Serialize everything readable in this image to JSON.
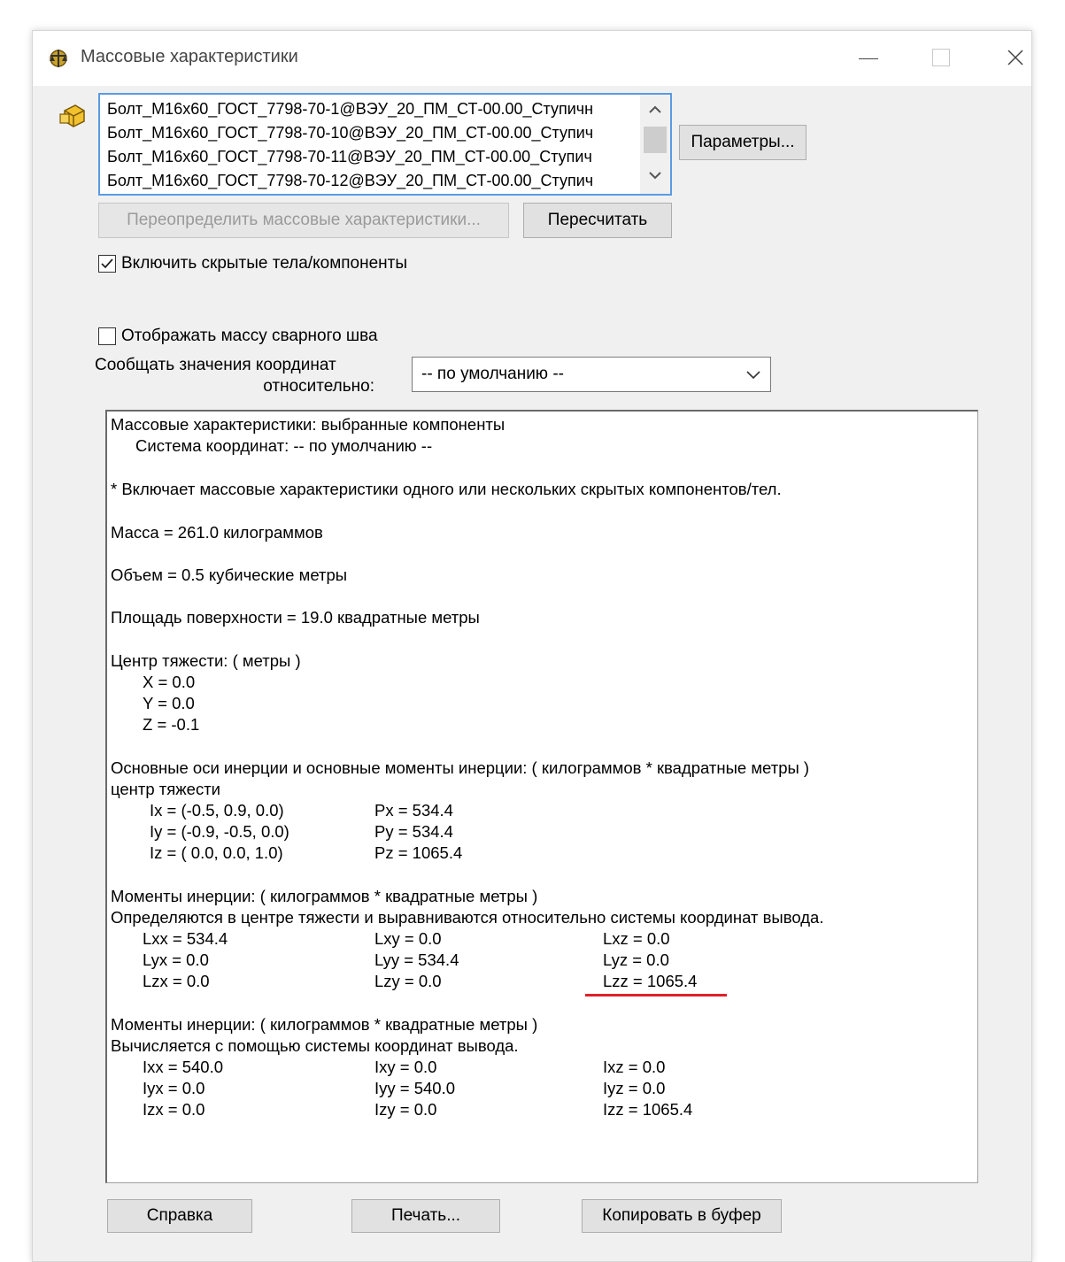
{
  "window": {
    "title": "Массовые характеристики"
  },
  "list": {
    "items": [
      "Болт_М16х60_ГОСТ_7798-70-1@ВЭУ_20_ПМ_СТ-00.00_Ступичн",
      "Болт_М16х60_ГОСТ_7798-70-10@ВЭУ_20_ПМ_СТ-00.00_Ступич",
      "Болт_М16х60_ГОСТ_7798-70-11@ВЭУ_20_ПМ_СТ-00.00_Ступич",
      "Болт_М16х60_ГОСТ_7798-70-12@ВЭУ_20_ПМ_СТ-00.00_Ступич"
    ]
  },
  "buttons": {
    "params": "Параметры...",
    "override": "Переопределить массовые характеристики...",
    "recalc": "Пересчитать",
    "help": "Справка",
    "print": "Печать...",
    "copy": "Копировать в буфер"
  },
  "options": {
    "include_hidden": {
      "label": "Включить скрытые тела/компоненты",
      "checked": true
    },
    "show_weld_mass": {
      "label": "Отображать массу сварного шва",
      "checked": false
    },
    "coord_label_line1": "Сообщать значения координат",
    "coord_label_line2": "относительно:",
    "coord_value": "-- по умолчанию --"
  },
  "results": {
    "header": "Массовые характеристики: выбранные компоненты",
    "coord_system": "Система координат: -- по умолчанию --",
    "note": "* Включает массовые характеристики одного или нескольких скрытых компонентов/тел.",
    "mass": "Масса = 261.0 килограммов",
    "volume": "Объем = 0.5 кубические метры",
    "area": "Площадь поверхности = 19.0 квадратные метры",
    "cog_title": "Центр тяжести: ( метры )",
    "cog_x": "X = 0.0",
    "cog_y": "Y = 0.0",
    "cog_z": "Z = -0.1",
    "principal_title": "Основные оси инерции и основные моменты инерции: ( килограммов * квадратные метры )",
    "principal_sub": "центр тяжести",
    "ix": "Ix = (-0.5,  0.9,  0.0)",
    "iy": "Iy = (-0.9, -0.5,  0.0)",
    "iz": "Iz = ( 0.0,  0.0,  1.0)",
    "px": "Px = 534.4",
    "py": "Py = 534.4",
    "pz": "Pz = 1065.4",
    "moments1_title": "Моменты инерции: ( килограммов * квадратные метры )",
    "moments1_sub": "Определяются в центре тяжести и выравниваются относительно системы координат вывода.",
    "lxx": "Lxx = 534.4",
    "lxy": "Lxy = 0.0",
    "lxz": "Lxz = 0.0",
    "lyx": "Lyx = 0.0",
    "lyy": "Lyy = 534.4",
    "lyz": "Lyz = 0.0",
    "lzx": "Lzx = 0.0",
    "lzy": "Lzy = 0.0",
    "lzz": "Lzz = 1065.4",
    "moments2_title": "Моменты инерции: ( килограммов * квадратные метры )",
    "moments2_sub": "Вычисляется с помощью системы координат вывода.",
    "ixx": "Ixx = 540.0",
    "ixy": "Ixy = 0.0",
    "ixz": "Ixz = 0.0",
    "iyx": "Iyx = 0.0",
    "iyy": "Iyy = 540.0",
    "iyz": "Iyz = 0.0",
    "izx": "Izx = 0.0",
    "izy": "Izy = 0.0",
    "izz": "Izz = 1065.4"
  },
  "colors": {
    "accent": "#5a9be3",
    "highlight_underline": "#e0202a"
  }
}
